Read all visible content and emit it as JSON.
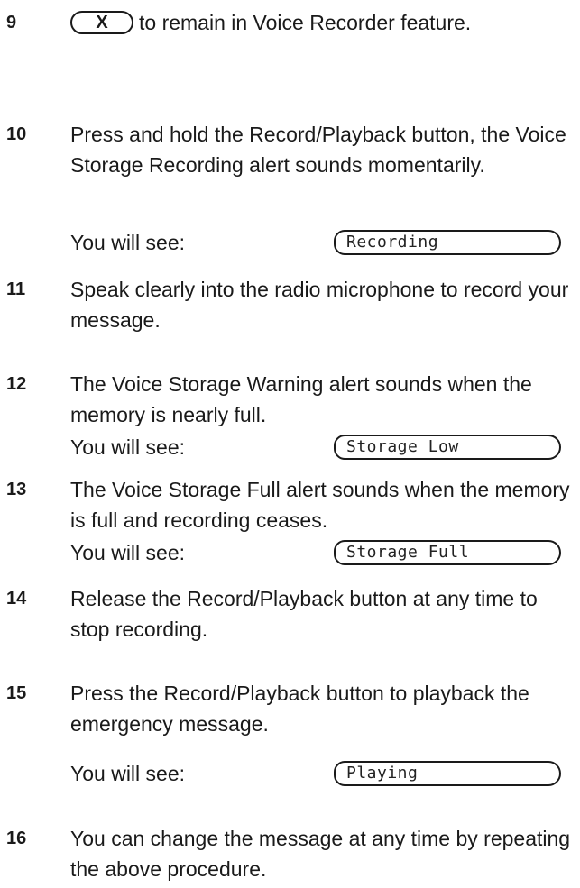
{
  "steps": [
    {
      "num": "9",
      "key": "X",
      "text": "to remain in Voice Recorder feature."
    },
    {
      "num": "10",
      "text": "Press and hold the Record/Playback button, the Voice Storage Recording alert sounds momentarily.",
      "see_label": "You will see:",
      "display": "Recording"
    },
    {
      "num": "11",
      "text": "Speak clearly into the radio microphone to record your message."
    },
    {
      "num": "12",
      "text": "The Voice Storage Warning alert sounds when the memory is nearly full.",
      "see_label": "You will see:",
      "display": "Storage Low"
    },
    {
      "num": "13",
      "text": "The Voice Storage Full alert sounds when the memory is full and recording ceases.",
      "see_label": "You will see:",
      "display": "Storage Full"
    },
    {
      "num": "14",
      "text": "Release the Record/Playback button at any time to stop recording."
    },
    {
      "num": "15",
      "text": "Press the Record/Playback button to playback the emergency message.",
      "see_label": "You will see:",
      "display": "Playing"
    },
    {
      "num": "16",
      "text": "You can change the message at any time by repeating the above procedure."
    }
  ]
}
